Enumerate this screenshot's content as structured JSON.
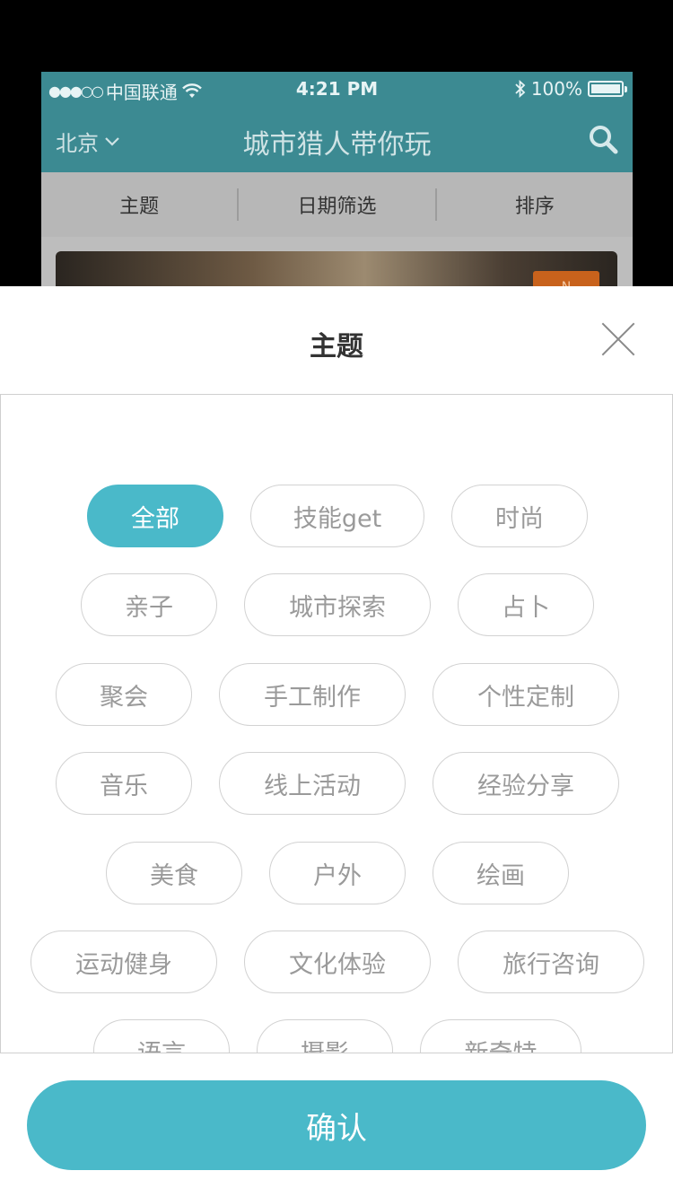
{
  "status_bar": {
    "signal_dots": "●●●○○",
    "carrier": "中国联通",
    "time": "4:21 PM",
    "battery": "100%"
  },
  "nav": {
    "city": "北京",
    "title": "城市猎人带你玩"
  },
  "filters": [
    {
      "label": "主题"
    },
    {
      "label": "日期筛选"
    },
    {
      "label": "排序"
    }
  ],
  "card_badge": "N",
  "sheet": {
    "title": "主题",
    "confirm_label": "确认"
  },
  "tags": [
    {
      "label": "全部",
      "selected": true
    },
    {
      "label": "技能get"
    },
    {
      "label": "时尚"
    },
    {
      "label": "亲子"
    },
    {
      "label": "城市探索"
    },
    {
      "label": "占卜"
    },
    {
      "label": "聚会"
    },
    {
      "label": "手工制作"
    },
    {
      "label": "个性定制"
    },
    {
      "label": "音乐"
    },
    {
      "label": "线上活动"
    },
    {
      "label": "经验分享"
    },
    {
      "label": "美食"
    },
    {
      "label": "户外"
    },
    {
      "label": "绘画"
    },
    {
      "label": "运动健身"
    },
    {
      "label": "文化体验"
    },
    {
      "label": "旅行咨询"
    },
    {
      "label": "语言"
    },
    {
      "label": "摄影"
    },
    {
      "label": "新奇特"
    }
  ],
  "colors": {
    "accent": "#4ab9c9",
    "nav_dimmed": "#3c8a92"
  }
}
